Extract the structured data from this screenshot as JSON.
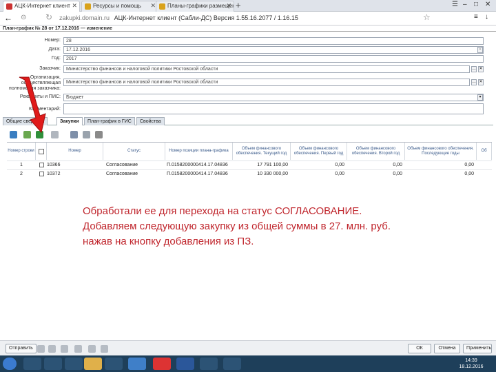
{
  "browser": {
    "tabs": [
      {
        "label": "АЦК-Интернет клиент",
        "active": true
      },
      {
        "label": "Ресурсы и помощь",
        "active": false
      },
      {
        "label": "Планы-графики размещения",
        "active": false
      }
    ],
    "url": "zakupki.domain.ru",
    "page_title": "АЦК-Интернет клиент (Сабли-ДС) Версия 1.55.16.2077 / 1.16.15"
  },
  "window_title": "План-график № 28 от 17.12.2016 — изменение",
  "form": {
    "number_label": "Номер:",
    "number_value": "28",
    "date_label": "Дата:",
    "date_value": "17.12.2016",
    "year_label": "Год:",
    "year_value": "2017",
    "customer_label": "Заказчик:",
    "customer_value": "Министерство финансов и налоговой политики Ростовской области",
    "org_label": "Организация, осуществляющая полномочия заказчика:",
    "org_value": "Министерство финансов и налоговой политики Ростовской области",
    "regs_label": "Реквизиты и ПИС:",
    "regs_value": "Бюджет",
    "comment_label": "Комментарий:",
    "comment_value": ""
  },
  "form_tabs": [
    "Общие сведения",
    "Закупки",
    "План-график в ГИС",
    "Свойства"
  ],
  "grid": {
    "headers": [
      "Номер строки",
      "",
      "Номер",
      "Статус",
      "Номер позиции плана-графика",
      "Объем финансового обеспечения. Текущий год",
      "Объем финансового обеспечения. Первый год",
      "Объем финансового обеспечения. Второй год",
      "Объем финансового обеспечения. Последующие годы",
      "Об"
    ],
    "rows": [
      {
        "line": "1",
        "num": "10366",
        "status": "Согласование",
        "pos": "П.0158200000414.17.04836",
        "cur": "17 791 100,00",
        "y1": "0,00",
        "y2": "0,00",
        "next": "0,00"
      },
      {
        "line": "2",
        "num": "10372",
        "status": "Согласование",
        "pos": "П.0158200000414.17.04836",
        "cur": "10 330 000,00",
        "y1": "0,00",
        "y2": "0,00",
        "next": "0,00"
      }
    ]
  },
  "annotation": [
    "Обработали ее для перехода на статус СОГЛАСОВАНИЕ.",
    "Добавляем следующую закупку из общей суммы в 27. млн. руб.",
    "нажав на кнопку добавления из ПЗ."
  ],
  "bottom": {
    "send_label": "Отправить",
    "ok_label": "ОК",
    "cancel_label": "Отмена",
    "apply_label": "Применить"
  },
  "taskbar": {
    "time": "14:39",
    "date": "18.12.2016"
  },
  "colors": {
    "accent_red": "#c0262d",
    "taskbar": "#1e3f5a"
  }
}
